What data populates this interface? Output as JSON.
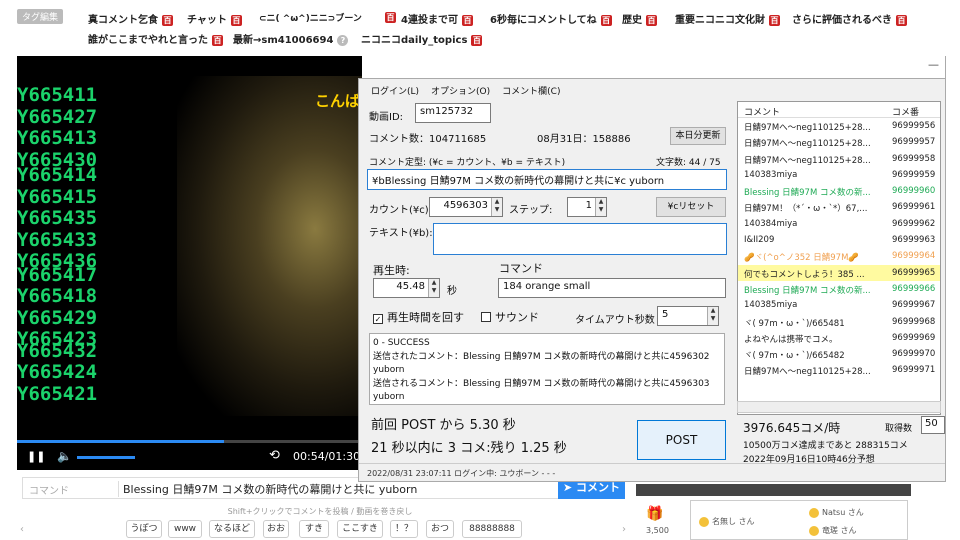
{
  "tags": {
    "edit_label": "タグ編集",
    "items": [
      {
        "label": "真コメント乞食",
        "badge": "百"
      },
      {
        "label": "チャット",
        "badge": "百"
      },
      {
        "label": "⊂ニ( ^ω^)ニニ⊃ブーン",
        "badge": "百"
      },
      {
        "label": "4連投まで可",
        "badge": "百"
      },
      {
        "label": "6秒毎にコメントしてね",
        "badge": "百"
      },
      {
        "label": "歴史",
        "badge": "百"
      },
      {
        "label": "重要ニコニコ文化財",
        "badge": "百"
      },
      {
        "label": "さらに評価されるべき",
        "badge": "百"
      },
      {
        "label": "誰がここまでやれと言った",
        "badge": "百"
      },
      {
        "label": "最新→sm41006694",
        "badge": "?"
      },
      {
        "label": "ニコニコdaily_topics",
        "badge": "百"
      }
    ]
  },
  "video": {
    "comments": [
      "Y665411",
      "Y665427",
      "Y665413",
      "Y665430",
      "Y665414",
      "Y665415",
      "Y665435",
      "Y665433",
      "Y665436",
      "Y665417",
      "Y665418",
      "Y665429",
      "Y665423",
      "Y665432",
      "Y665424",
      "Y665421"
    ],
    "yellow_comment": "こんば",
    "time": "00:54/01:30",
    "progress": 0.6
  },
  "comment_bar": {
    "command_placeholder": "コマンド",
    "text": "Blessing 日鯖97M コメ数の新時代の幕開けと共に yuborn",
    "send": "コメント"
  },
  "hint": "Shift+クリックでコメントを投稿 / 動画を巻き戻し",
  "quick": [
    "うぽつ",
    "www",
    "なるほど",
    "おお",
    "すき",
    "ここすき",
    "！？",
    "おつ",
    "88888888"
  ],
  "gift": {
    "count": "3,500"
  },
  "cards": [
    {
      "name": "名無し",
      "suffix": "さん"
    },
    {
      "name": "Natsu",
      "suffix": "さん"
    },
    {
      "name": "竜瑳",
      "suffix": "さん"
    }
  ],
  "tool": {
    "menu": [
      "ログイン(L)",
      "オプション(O)",
      "コメント欄(C)"
    ],
    "video_id_label": "動画ID:",
    "video_id": "sm125732",
    "comment_count": "コメント数：104711685",
    "daily": "08月31日：158886",
    "update_btn": "本日分更新",
    "template_label": "コメント定型: (¥c = カウント、¥b = テキスト)",
    "char_count": "文字数: 44 / 75",
    "template": "¥bBlessing 日鯖97M コメ数の新時代の幕開けと共に¥c yuborn",
    "count_label": "カウント(¥c):",
    "count": "4596303",
    "step_label": "ステップ:",
    "step": "1",
    "reset_btn": "¥cリセット",
    "text_label": "テキスト(¥b):",
    "text": "",
    "playtime_label": "再生時:",
    "playtime": "45.48",
    "sec": "秒",
    "command_label": "コマンド",
    "command": "184 orange small",
    "loop_label": "再生時間を回す",
    "sound_label": "サウンド",
    "timeout_label": "タイムアウト秒数",
    "timeout": "5",
    "log": [
      "0 - SUCCESS",
      "送信されたコメント：Blessing 日鯖97M コメ数の新時代の幕開けと共に4596302",
      "yuborn",
      "送信されるコメント：Blessing 日鯖97M コメ数の新時代の幕開けと共に4596303",
      "yuborn"
    ],
    "last_post": "前回 POST から 5.30 秒",
    "rate_limit": "21 秒以内に 3 コメ:残り 1.25 秒",
    "post_btn": "POST",
    "status": "2022/08/31 23:07:11   ログイン中: ユウボーン   -   -   -",
    "list_headers": [
      "コメント",
      "コメ番"
    ],
    "rows": [
      {
        "c": "日鯖97Mへ～neg110125+28...",
        "n": "96999956",
        "style": ""
      },
      {
        "c": "日鯖97Mへ～neg110125+28...",
        "n": "96999957",
        "style": ""
      },
      {
        "c": "日鯖97Mへ～neg110125+28...",
        "n": "96999958",
        "style": ""
      },
      {
        "c": "140383miya",
        "n": "96999959",
        "style": ""
      },
      {
        "c": "Blessing 日鯖97M コメ数の新...",
        "n": "96999960",
        "style": "green"
      },
      {
        "c": "日鯖97M！（*´・ω・`*）67,...",
        "n": "96999961",
        "style": ""
      },
      {
        "c": "140384miya",
        "n": "96999962",
        "style": ""
      },
      {
        "c": "I&II209",
        "n": "96999963",
        "style": ""
      },
      {
        "c": "🥜ヾ(^o^ノ352 日鯖97M🥜",
        "n": "96999964",
        "style": "orange"
      },
      {
        "c": "何でもコメントしよう！385 ...",
        "n": "96999965",
        "style": "hl"
      },
      {
        "c": "Blessing 日鯖97M コメ数の新...",
        "n": "96999966",
        "style": "green"
      },
      {
        "c": "140385miya",
        "n": "96999967",
        "style": ""
      },
      {
        "c": "ヾ( 97m・ω・`)/665481",
        "n": "96999968",
        "style": ""
      },
      {
        "c": "よねやんは携帯でコメ。",
        "n": "96999969",
        "style": ""
      },
      {
        "c": "ヾ( 97m・ω・`)/665482",
        "n": "96999970",
        "style": ""
      },
      {
        "c": "日鯖97Mへ～neg110125+28...",
        "n": "96999971",
        "style": ""
      }
    ],
    "rate": "3976.645コメ/時",
    "fetch_label": "取得数",
    "fetch": "50",
    "goal": "10500万コメ達成まであと  288315コメ",
    "eta": "2022年09月16日10時46分予想"
  }
}
